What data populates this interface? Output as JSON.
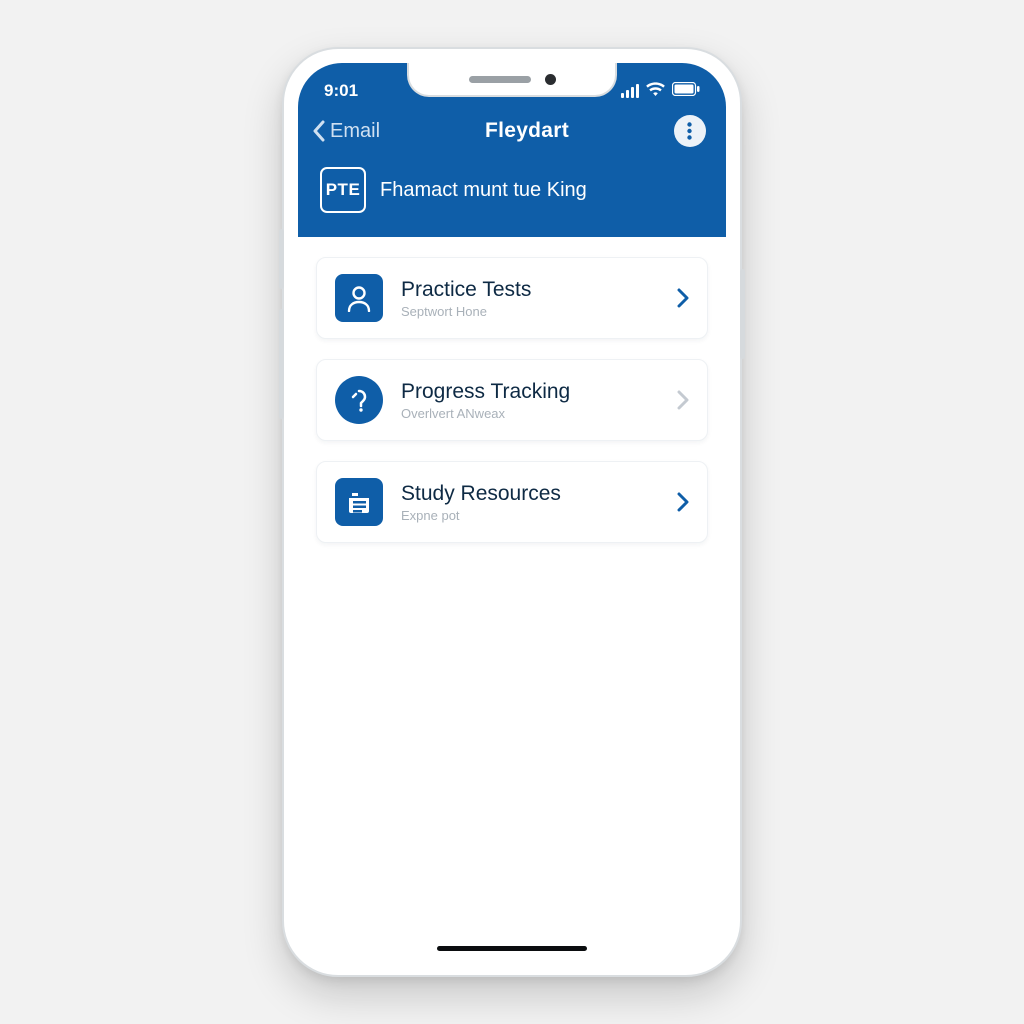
{
  "status": {
    "time": "9:01"
  },
  "nav": {
    "back_label": "Email",
    "title": "Fleydart"
  },
  "subheader": {
    "badge": "PTE",
    "text": "Fhamact munt tue King"
  },
  "cards": [
    {
      "title": "Practice Tests",
      "subtitle": "Septwort Hone",
      "icon": "person-icon",
      "chevron": "strong"
    },
    {
      "title": "Progress Tracking",
      "subtitle": "Overlvert ANweax",
      "icon": "activity-icon",
      "chevron": "muted"
    },
    {
      "title": "Study Resources",
      "subtitle": "Expne pot",
      "icon": "document-icon",
      "chevron": "strong"
    }
  ]
}
